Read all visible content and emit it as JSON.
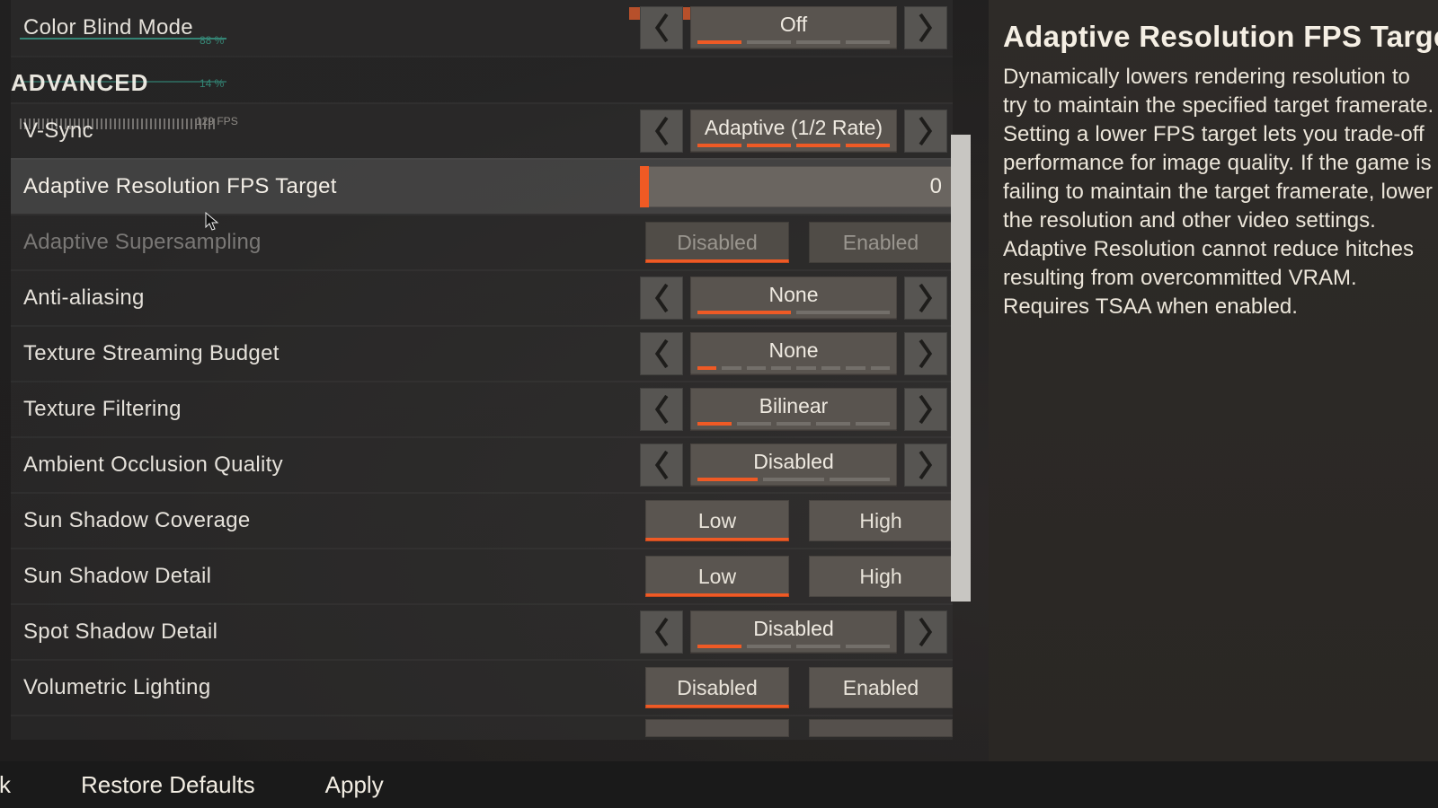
{
  "perf_overlay": {
    "pct1": "88 %",
    "pct2": "14 %",
    "fps": "129  FPS"
  },
  "section_advanced": "ADVANCED",
  "rows": {
    "color_blind": {
      "label": "Color Blind Mode",
      "value": "Off",
      "ticks_total": 4,
      "ticks_on": 1
    },
    "vsync": {
      "label": "V-Sync",
      "value": "Adaptive (1/2 Rate)",
      "ticks_total": 4,
      "ticks_on": 4
    },
    "adaptive_res": {
      "label": "Adaptive Resolution FPS Target",
      "value": "0"
    },
    "adaptive_ss": {
      "label": "Adaptive Supersampling",
      "opts": [
        "Disabled",
        "Enabled"
      ],
      "selected": 0,
      "dim": true
    },
    "aa": {
      "label": "Anti-aliasing",
      "value": "None",
      "ticks_total": 2,
      "ticks_on": 1
    },
    "tex_budget": {
      "label": "Texture Streaming Budget",
      "value": "None",
      "ticks_total": 8,
      "ticks_on": 1
    },
    "tex_filter": {
      "label": "Texture Filtering",
      "value": "Bilinear",
      "ticks_total": 5,
      "ticks_on": 1
    },
    "ao": {
      "label": "Ambient Occlusion Quality",
      "value": "Disabled",
      "ticks_total": 3,
      "ticks_on": 1
    },
    "sun_cov": {
      "label": "Sun Shadow Coverage",
      "opts": [
        "Low",
        "High"
      ],
      "selected": 0
    },
    "sun_det": {
      "label": "Sun Shadow Detail",
      "opts": [
        "Low",
        "High"
      ],
      "selected": 0
    },
    "spot_det": {
      "label": "Spot Shadow Detail",
      "value": "Disabled",
      "ticks_total": 4,
      "ticks_on": 1
    },
    "vol_light": {
      "label": "Volumetric Lighting",
      "opts": [
        "Disabled",
        "Enabled"
      ],
      "selected": 0
    }
  },
  "info": {
    "title": "Adaptive Resolution FPS Target",
    "body": "Dynamically lowers rendering resolution to try to maintain the specified target framerate. Setting a lower FPS target lets you trade-off performance for image quality. If the game is failing to maintain the target framerate, lower the resolution and other video settings. Adaptive Resolution cannot reduce hitches resulting from overcommitted VRAM. Requires TSAA when enabled."
  },
  "footer": {
    "back": "ck",
    "restore": "Restore Defaults",
    "apply": "Apply"
  },
  "colors": {
    "accent": "#ef5a25"
  }
}
